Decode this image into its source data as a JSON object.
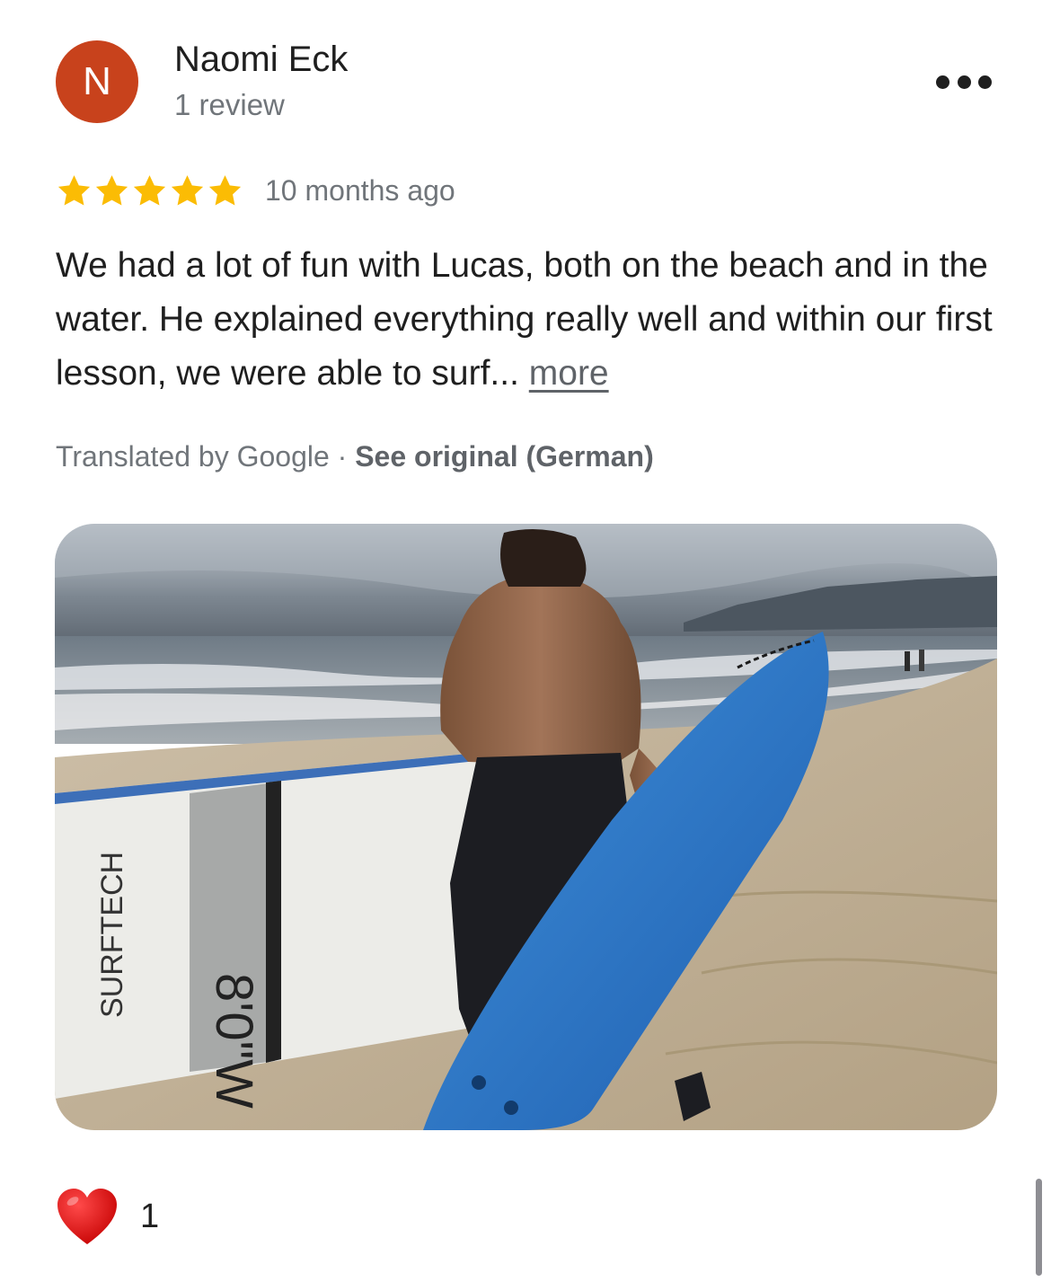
{
  "review": {
    "author": {
      "initial": "N",
      "name": "Naomi Eck",
      "meta": "1 review",
      "avatar_color": "#c8421c"
    },
    "rating": 5,
    "rating_max": 5,
    "star_color": "#fbbc04",
    "time_ago": "10 months ago",
    "text": "We had a lot of fun with Lucas, both on the beach and in the water. He explained everything really well and within our first lesson, we were able to surf...",
    "more_label": "more",
    "translated_label": "Translated by Google · ",
    "see_original_label": "See original (German)",
    "photo": {
      "icon": "beach-surfer-photo",
      "board_text_1": "SURFTECH",
      "board_text_2": "8'0\"W"
    },
    "reaction": {
      "icon": "heart-icon",
      "count": "1"
    }
  },
  "menu": {
    "icon": "more-horizontal-icon"
  }
}
